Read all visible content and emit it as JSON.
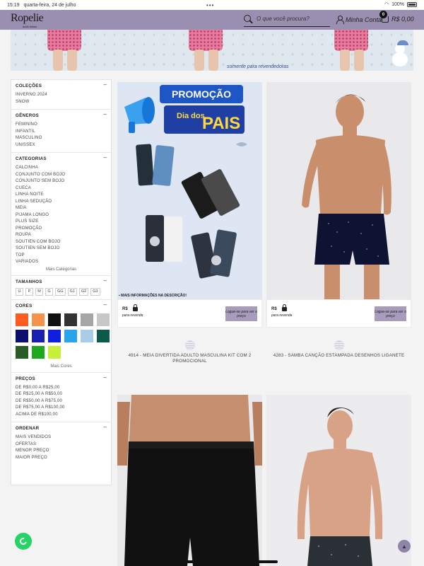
{
  "status": {
    "time": "15:19",
    "date": "quarta-feira, 24 de julho",
    "dots": "•••",
    "battery": "100%"
  },
  "header": {
    "logo": "Ropelie",
    "logo_sub": "moda íntima",
    "search_placeholder": "O que você procura?",
    "account_label": "Minha Conta",
    "cart_count": "0",
    "cart_total": "R$ 0,00"
  },
  "banner": {
    "tagline": "somente para revendedoras"
  },
  "sidebar": {
    "collections": {
      "title": "COLEÇÕES",
      "items": [
        "INVERNO 2024",
        "SNOW"
      ]
    },
    "genders": {
      "title": "GÊNEROS",
      "items": [
        "FEMININO",
        "INFANTIL",
        "MASCULINO",
        "UNISSEX"
      ]
    },
    "categories": {
      "title": "CATEGORIAS",
      "items": [
        "CALCINHA",
        "CONJUNTO COM BOJO",
        "CONJUNTO SEM BOJO",
        "CUECA",
        "LINHA NOITE",
        "LINHA SEDUÇÃO",
        "MEIA",
        "PIJAMA LONGO",
        "PLUS SIZE",
        "PROMOÇÃO",
        "ROUPA",
        "SOUTIEN COM BOJO",
        "SOUTIEN SEM BOJO",
        "TOP",
        "VARIADOS"
      ],
      "more": "Mais Categorias"
    },
    "sizes": {
      "title": "TAMANHOS",
      "items": [
        "U",
        "P",
        "M",
        "G",
        "GG",
        "G1",
        "G2",
        "G3"
      ]
    },
    "colors": {
      "title": "CORES",
      "swatches": [
        "#ff5a1f",
        "#f7924a",
        "#111111",
        "#333333",
        "#a6a6a6",
        "#c8c8c8",
        "#0d0f6e",
        "#1a1fb0",
        "#0f1fe0",
        "#29a4ef",
        "#a9cce8",
        "#0c5a4c",
        "#2a5a26",
        "#1ea81e",
        "#c6f03a"
      ],
      "more": "Mais Cores"
    },
    "prices": {
      "title": "PREÇOS",
      "items": [
        "DE R$0,00 A R$25,00",
        "DE R$25,00 A R$50,00",
        "DE R$50,00 A R$75,00",
        "DE R$75,00 A R$100,00",
        "ACIMA DE R$100,00"
      ]
    },
    "order": {
      "title": "ORDENAR",
      "items": [
        "MAIS VENDIDOS",
        "OFERTAS",
        "MENOR PREÇO",
        "MAIOR PREÇO"
      ]
    },
    "toggle_symbol": "–"
  },
  "products": [
    {
      "title": "4914 - MEIA DIVERTIDA ADULTO MASCULINA KIT COM 2 PROMOCIONAL",
      "promo_top": "PROMOÇÃO",
      "promo_mid": "Dia dos",
      "promo_big": "PAIS",
      "info": "MAIS INFORMAÇÕES NA DESCRIÇÃO!",
      "price_label": "R$",
      "revenda": "para revenda",
      "login": "Logue-se para ver o preço"
    },
    {
      "title": "4283 - SAMBA CANÇÃO ESTAMPADA DESENHOS LIGANETE",
      "price_label": "R$",
      "revenda": "para revenda",
      "login": "Logue-se para ver o preço"
    }
  ],
  "colors": {
    "header": "#9b8fb1",
    "login_button": "#a79cbb",
    "whatsapp": "#25d366"
  }
}
